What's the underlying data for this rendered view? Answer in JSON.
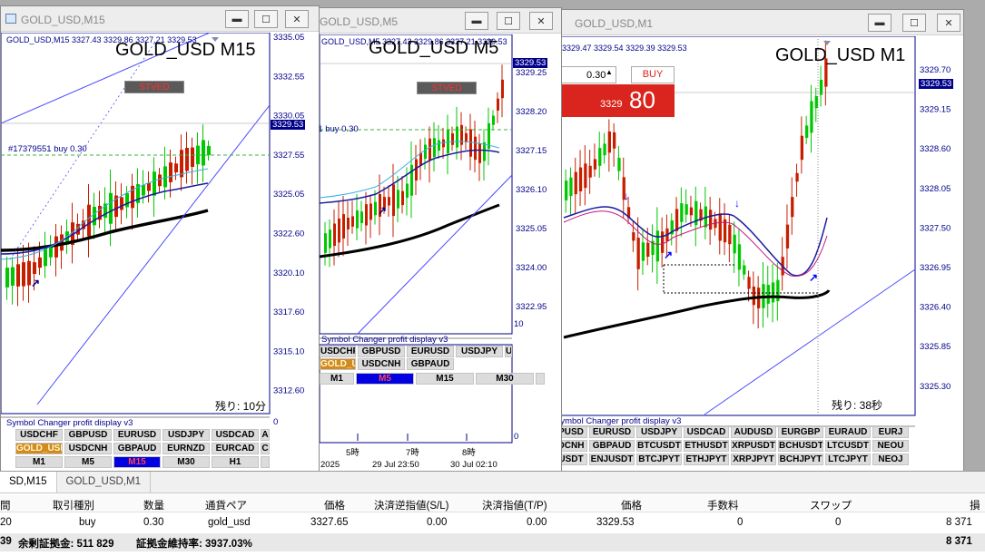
{
  "windows": {
    "w1": {
      "title": "GOLD_USD,M15",
      "header": "GOLD_USD,M15  3327.43 3329.86 3327.21 3329.53",
      "symbol_label": "GOLD_USD M15",
      "stvd_label": "STVED",
      "trade_label": "#17379551 buy 0.30",
      "current_price": "3329.53",
      "countdown": "残り: 10分",
      "prices": [
        "3335.05",
        "3332.55",
        "3330.05",
        "3327.55",
        "3325.05",
        "3322.60",
        "3320.10",
        "3317.60",
        "3315.10",
        "3312.60"
      ],
      "sub_zero": "0",
      "sc_title": "Symbol Changer profit display v3",
      "sc_row1": [
        "USDCHF",
        "GBPUSD",
        "EURUSD",
        "USDJPY",
        "USDCAD",
        "A"
      ],
      "sc_row2": [
        "GOLD_USD",
        "USDCNH",
        "GBPAUD",
        "EURNZD",
        "EURCAD",
        "C"
      ],
      "tf": [
        "M1",
        "M5",
        "M15",
        "M30",
        "H1"
      ]
    },
    "w2": {
      "title": "GOLD_USD,M5",
      "header": "GOLD_USD,M5  3327.43 3329.86 3327.21 3329.53",
      "symbol_label": "GOLD_USD M5",
      "stvd_label": "STVED",
      "trade_label": "#17379551 buy 0.30",
      "current_price": "3329.53",
      "prices": [
        "3329.25",
        "3328.20",
        "3327.15",
        "3326.10",
        "3325.05",
        "3324.00",
        "3322.95"
      ],
      "sub_top": "10",
      "sub_zero": "0",
      "sc_title": "Symbol Changer profit display v3",
      "sc_row1": [
        "USDCHF",
        "GBPUSD",
        "EURUSD",
        "USDJPY",
        "U"
      ],
      "sc_row2": [
        "GOLD_USD",
        "USDCNH",
        "GBPAUD"
      ],
      "tf": [
        "M1",
        "M5",
        "M15",
        "M30"
      ],
      "time_labels": [
        "5時",
        "7時",
        "8時"
      ],
      "date_labels": [
        "2025",
        "29 Jul 23:50",
        "30 Jul 02:10"
      ]
    },
    "w3": {
      "title": "GOLD_USD,M1",
      "symbol_label": "GOLD_USD M1",
      "header": "3329.47 3329.54 3329.39 3329.53",
      "lot": "0.30",
      "buy_label": "BUY",
      "buy_price_small": "3329",
      "buy_price_big": "80",
      "current_price": "3329.53",
      "countdown": "残り: 38秒",
      "prices": [
        "3329.70",
        "3329.15",
        "3328.60",
        "3328.05",
        "3327.50",
        "3326.95",
        "3326.40",
        "3325.85",
        "3325.30"
      ],
      "sub_zero": "0",
      "sc_title": "Symbol Changer profit display v3",
      "sc_row1": [
        "PUSD",
        "EURUSD",
        "USDJPY",
        "USDCAD",
        "AUDUSD",
        "EURGBP",
        "EURAUD",
        "EURJ"
      ],
      "sc_row2": [
        "DCNH",
        "GBPAUD",
        "BTCUSDT",
        "ETHUSDT",
        "XRPUSDT",
        "BCHUSDT",
        "LTCUSDT",
        "NEOU"
      ],
      "sc_row3": [
        "USDT",
        "ENJUSDT",
        "BTCJPYT",
        "ETHJPYT",
        "XRPJPYT",
        "BCHJPYT",
        "LTCJPYT",
        "NEOJ"
      ]
    }
  },
  "terminal": {
    "tabs": [
      "SD,M15",
      "GOLD_USD,M1"
    ],
    "columns": [
      "間",
      "取引種別",
      "数量",
      "通貨ペア",
      "価格",
      "決済逆指値(S/L)",
      "決済指値(T/P)",
      "価格",
      "手数料",
      "スワップ",
      "損"
    ],
    "row": {
      "time": "20",
      "type": "buy",
      "volume": "0.30",
      "symbol": "gold_usd",
      "open_price": "3327.65",
      "sl": "0.00",
      "tp": "0.00",
      "price": "3329.53",
      "commission": "0",
      "swap": "0",
      "profit": "8 371"
    },
    "summary": {
      "prefix": "39",
      "balance_label": "余剰証拠金: 511 829",
      "margin_label": "証拠金維持率: 3937.03%",
      "total": "8 371"
    }
  },
  "colors": {
    "accent_blue": "#00008b",
    "bull": "#00c800",
    "bear": "#c81e00",
    "buy_red": "#d9251d"
  }
}
